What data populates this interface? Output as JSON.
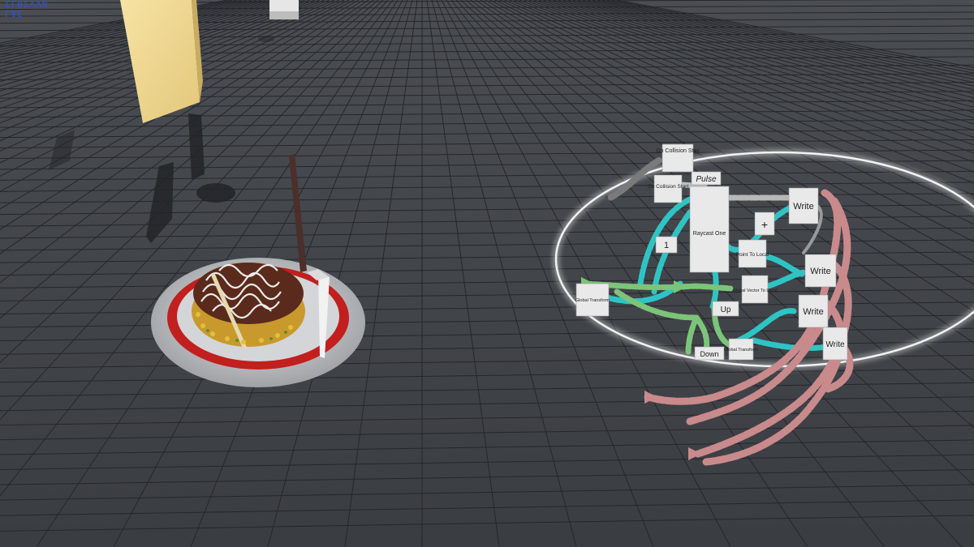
{
  "hud": {
    "line1": "ΣΓΒΣΛΛΝ",
    "line2": "ΓΨΣ"
  },
  "colors": {
    "ground": "#3c3f44",
    "grid": "#25272b",
    "node_card": "#e9e9e9",
    "impulse_wire": "#c98a8c",
    "value_wire": "#2fc4c4",
    "vector_wire": "#7cc47a",
    "note_panel": "#f3d98e",
    "ring": "#ffffff"
  },
  "nodes": {
    "on_collision_stay": "On Collision Stay",
    "on_collision_start": "On Collision Start",
    "pulse": "Pulse",
    "raycast_one": "Raycast One",
    "write_1": "Write",
    "write_2": "Write",
    "write_3": "Write",
    "write_4": "Write",
    "add": "+",
    "point_to_local": "Point To Local",
    "global_vector_to_local": "Global Vector To Local",
    "global_transform_1": "Global Transform",
    "global_transform_2": "Global Transform",
    "one": "1",
    "up": "Up",
    "down": "Down"
  }
}
